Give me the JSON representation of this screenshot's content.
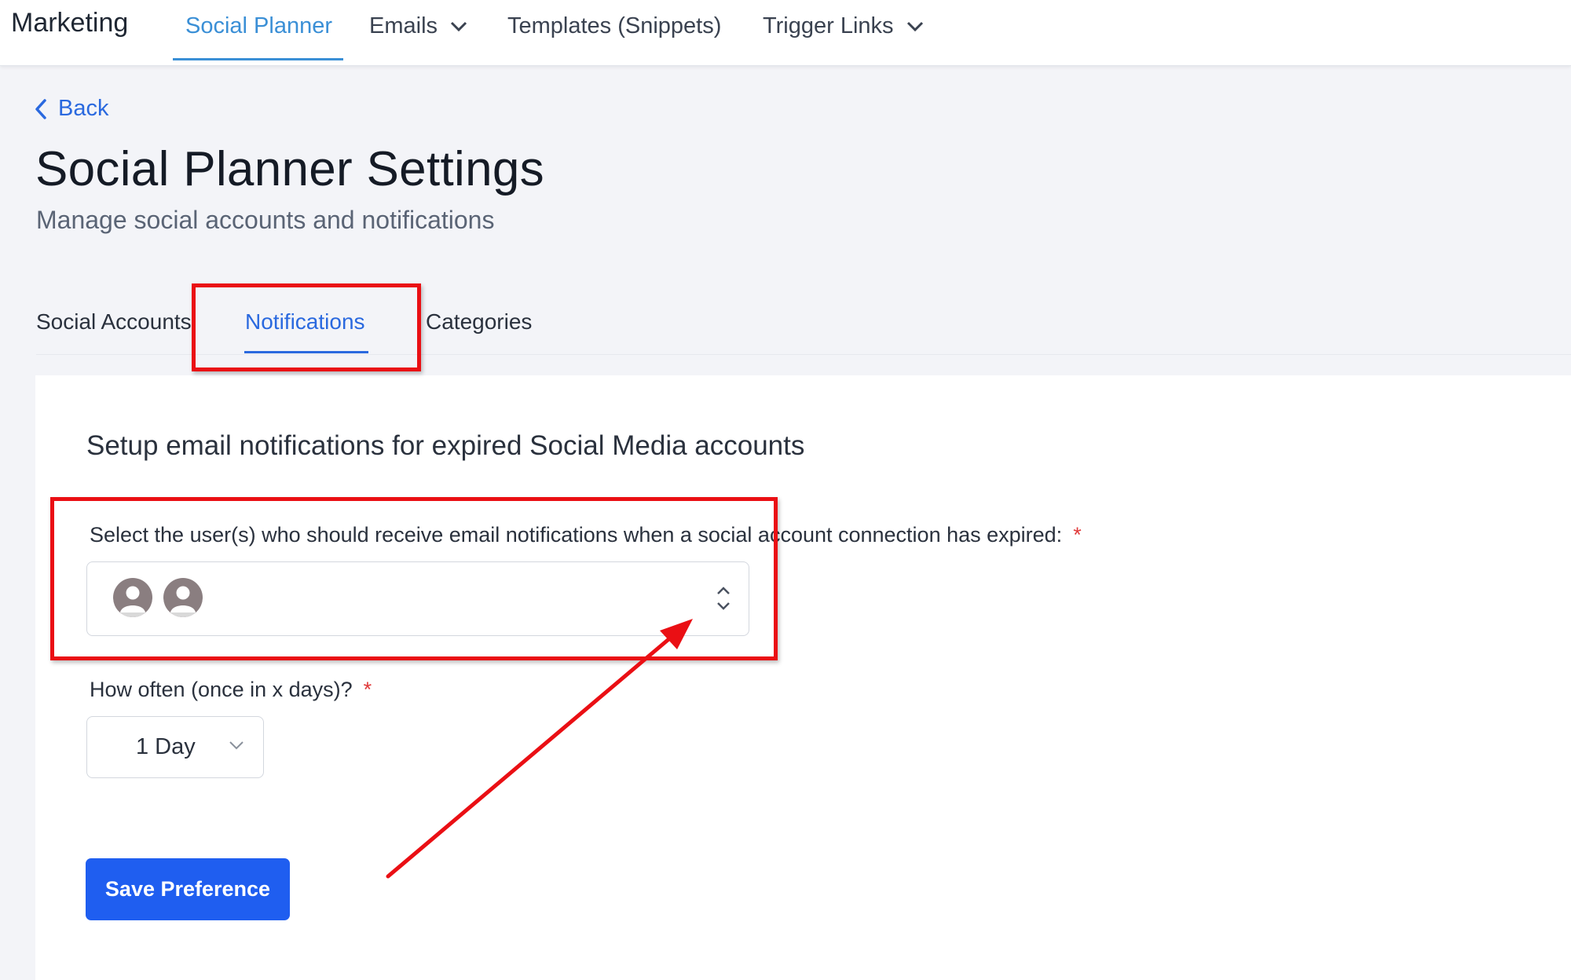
{
  "topnav": {
    "brand": "Marketing",
    "items": [
      {
        "label": "Social Planner",
        "active": true
      },
      {
        "label": "Emails",
        "has_dropdown": true
      },
      {
        "label": "Templates (Snippets)"
      },
      {
        "label": "Trigger Links",
        "has_dropdown": true
      }
    ]
  },
  "back_label": "Back",
  "page": {
    "title": "Social Planner Settings",
    "subtitle": "Manage social accounts and notifications"
  },
  "tabs": [
    {
      "label": "Social Accounts"
    },
    {
      "label": "Notifications",
      "active": true
    },
    {
      "label": "Categories"
    }
  ],
  "panel": {
    "section_title": "Setup email notifications for expired Social Media accounts",
    "users_field": {
      "label": "Select the user(s) who should receive email notifications when a social account connection has expired:",
      "required_mark": "*",
      "selected_avatars": [
        "user-avatar-icon",
        "user-avatar-icon"
      ]
    },
    "frequency_field": {
      "label": "How often (once in x days)?",
      "required_mark": "*",
      "value": "1 Day"
    },
    "save_label": "Save Preference"
  },
  "colors": {
    "accent": "#2a69df",
    "nav_active": "#3a8fd6",
    "button": "#1f5ef0",
    "annotation": "#ea0f14",
    "required": "#e03a3a"
  }
}
